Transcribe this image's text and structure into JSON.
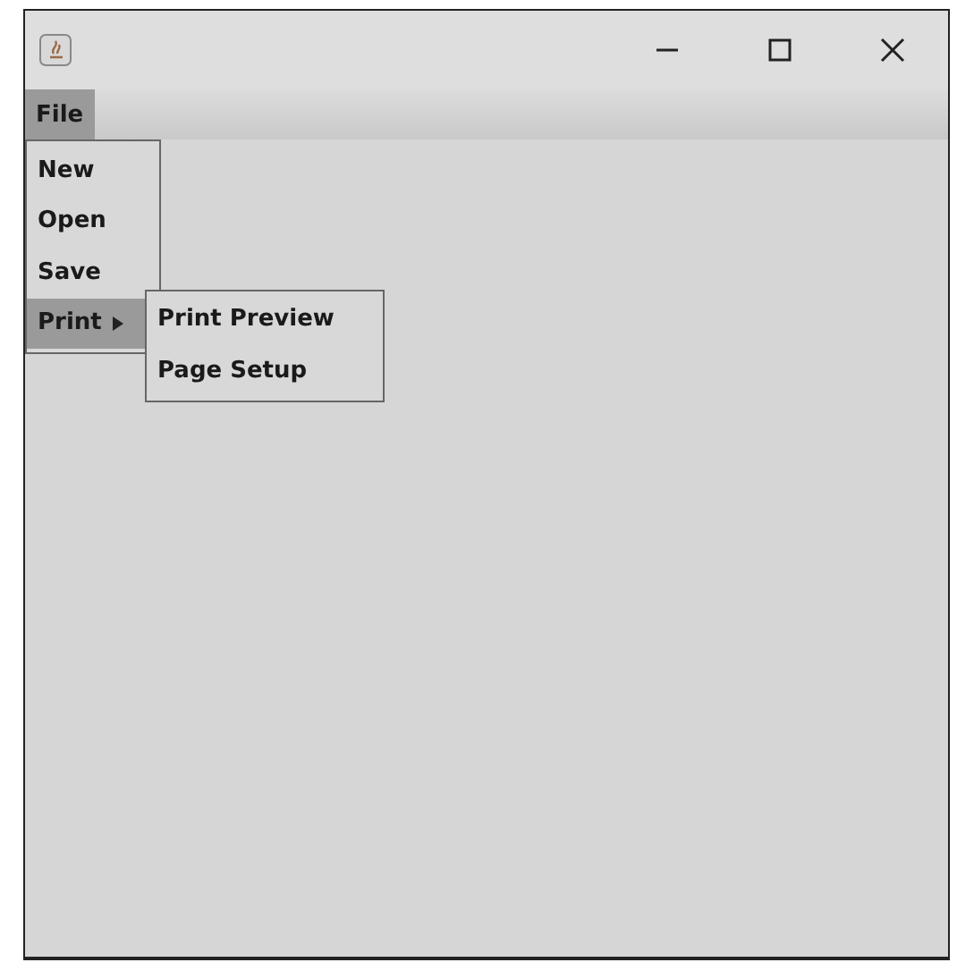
{
  "menu_bar": [
    {
      "label": "File",
      "selected": true,
      "items": [
        {
          "label": "New",
          "selected": false,
          "kind": "item"
        },
        {
          "label": "Open",
          "selected": false,
          "kind": "item"
        },
        {
          "label": "Save",
          "selected": false,
          "kind": "item"
        },
        {
          "label": "Print",
          "selected": true,
          "kind": "submenu",
          "children": [
            {
              "label": "Print Preview",
              "selected": false,
              "kind": "item"
            },
            {
              "label": "Page Setup",
              "selected": false,
              "kind": "item"
            }
          ]
        }
      ]
    }
  ]
}
